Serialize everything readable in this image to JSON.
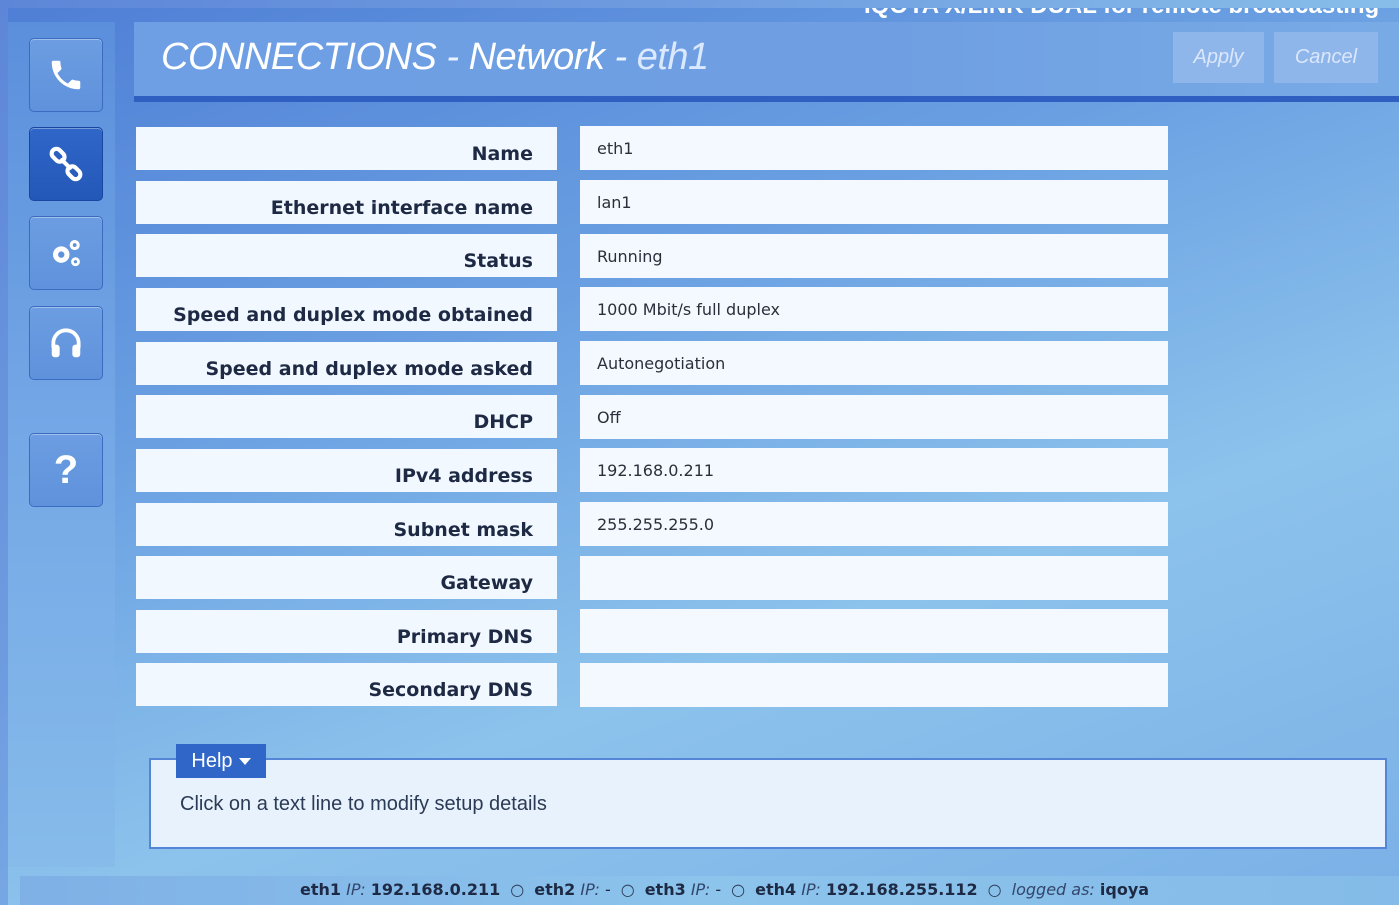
{
  "top_strip_text": "IQOYA X/LINK DUAL for remote broadcasting",
  "header": {
    "title_main": "CONNECTIONS",
    "title_sep1": " - ",
    "title_section": "Network",
    "title_sep2": " - ",
    "title_sub": "eth1",
    "apply_label": "Apply",
    "cancel_label": "Cancel"
  },
  "sidebar": {
    "items": [
      {
        "icon": "phone-icon"
      },
      {
        "icon": "link-icon",
        "active": true
      },
      {
        "icon": "gears-icon"
      },
      {
        "icon": "headphones-icon"
      },
      {
        "icon": "help-icon",
        "label": "?"
      }
    ]
  },
  "rows": [
    {
      "label": "Name",
      "value": "eth1"
    },
    {
      "label": "Ethernet interface name",
      "value": "lan1"
    },
    {
      "label": "Status",
      "value": "Running"
    },
    {
      "label": "Speed and duplex mode obtained",
      "value": "1000 Mbit/s full duplex"
    },
    {
      "label": "Speed and duplex mode asked",
      "value": "Autonegotiation"
    },
    {
      "label": "DHCP",
      "value": "Off"
    },
    {
      "label": "IPv4 address",
      "value": "192.168.0.211"
    },
    {
      "label": "Subnet mask",
      "value": "255.255.255.0"
    },
    {
      "label": "Gateway",
      "value": ""
    },
    {
      "label": "Primary DNS",
      "value": ""
    },
    {
      "label": "Secondary DNS",
      "value": ""
    }
  ],
  "help": {
    "tab_label": "Help",
    "text": "Click on a text line to modify setup details"
  },
  "footer": {
    "ip_label": "IP:",
    "eth1_name": "eth1",
    "eth1_ip": "192.168.0.211",
    "eth2_name": "eth2",
    "eth2_ip": "-",
    "eth3_name": "eth3",
    "eth3_ip": "-",
    "eth4_name": "eth4",
    "eth4_ip": "192.168.255.112",
    "logged_label": "logged as:",
    "user": "iqoya"
  },
  "colors": {
    "accent": "#2f66c8",
    "header_line": "#2f5fc0",
    "label_text": "#1e2a44"
  }
}
